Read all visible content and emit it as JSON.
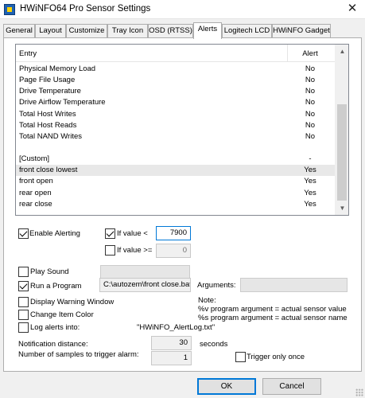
{
  "window": {
    "title": "HWiNFO64 Pro Sensor Settings",
    "close_glyph": "✕"
  },
  "tabs": [
    {
      "label": "General"
    },
    {
      "label": "Layout"
    },
    {
      "label": "Customize"
    },
    {
      "label": "Tray Icon"
    },
    {
      "label": "OSD (RTSS)"
    },
    {
      "label": "Alerts",
      "active": true
    },
    {
      "label": "Logitech LCD"
    },
    {
      "label": "HWiNFO Gadget"
    }
  ],
  "list": {
    "col_entry": "Entry",
    "col_alert": "Alert",
    "rows": [
      {
        "entry": "Physical Memory Load",
        "alert": "No"
      },
      {
        "entry": "Page File Usage",
        "alert": "No"
      },
      {
        "entry": "Drive Temperature",
        "alert": "No"
      },
      {
        "entry": "Drive Airflow Temperature",
        "alert": "No"
      },
      {
        "entry": "Total Host Writes",
        "alert": "No"
      },
      {
        "entry": "Total Host Reads",
        "alert": "No"
      },
      {
        "entry": "Total NAND Writes",
        "alert": "No"
      },
      {
        "entry": "",
        "alert": ""
      },
      {
        "entry": "[Custom]",
        "alert": "-"
      },
      {
        "entry": "front close lowest",
        "alert": "Yes"
      },
      {
        "entry": "front open",
        "alert": "Yes"
      },
      {
        "entry": "rear open",
        "alert": "Yes"
      },
      {
        "entry": "rear close",
        "alert": "Yes"
      }
    ],
    "selected_row": "front close lowest"
  },
  "alerting": {
    "enable_label": "Enable Alerting",
    "enable_checked": true,
    "if_value_lt_label": "If value  <",
    "if_value_lt_checked": true,
    "if_value_lt_value": "7900",
    "if_value_ge_label": "If value >=",
    "if_value_ge_checked": false,
    "if_value_ge_value": "0"
  },
  "actions": {
    "play_sound_label": "Play Sound",
    "play_sound_checked": false,
    "sound_path": "",
    "run_program_label": "Run a Program",
    "run_program_checked": true,
    "program_path": "C:\\autozem\\front close.bat",
    "arguments_label": "Arguments:",
    "arguments_value": "",
    "display_warning_label": "Display Warning Window",
    "display_warning_checked": false,
    "change_color_label": "Change Item Color",
    "change_color_checked": false,
    "log_alerts_label": "Log alerts into:",
    "log_alerts_checked": false,
    "log_file": "\"HWiNFO_AlertLog.txt\""
  },
  "note": {
    "title": "Note:",
    "line1": "%v program argument = actual sensor value",
    "line2": "%s program argument = actual sensor name"
  },
  "notification": {
    "distance_label": "Notification distance:",
    "distance_value": "30",
    "distance_unit": "seconds",
    "samples_label": "Number of samples to trigger alarm:",
    "samples_value": "1",
    "trigger_once_label": "Trigger only once",
    "trigger_once_checked": false
  },
  "buttons": {
    "ok": "OK",
    "cancel": "Cancel"
  }
}
